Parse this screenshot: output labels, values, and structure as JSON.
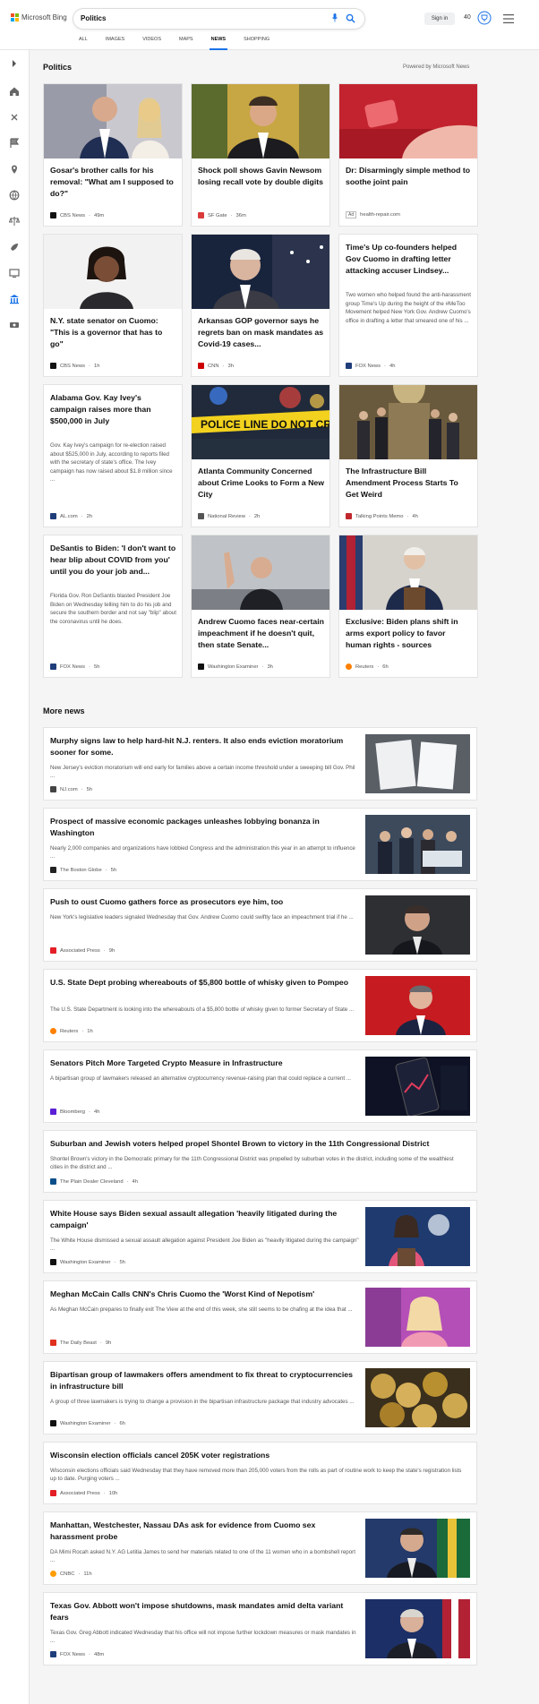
{
  "header": {
    "logo_text": "Microsoft Bing",
    "query": "Politics",
    "signin": "Sign in",
    "points": "40",
    "tabs": [
      {
        "label": "ALL"
      },
      {
        "label": "IMAGES"
      },
      {
        "label": "VIDEOS"
      },
      {
        "label": "MAPS"
      },
      {
        "label": "NEWS"
      },
      {
        "label": "SHOPPING"
      }
    ]
  },
  "section": {
    "title": "Politics",
    "powered": "Powered by Microsoft News"
  },
  "cards": [
    {
      "title": "Gosar's brother calls for his removal: \"What am I supposed to do?\"",
      "snippet": "",
      "source": "CBS News",
      "time": "49m"
    },
    {
      "title": "Shock poll shows Gavin Newsom losing recall vote by double digits",
      "snippet": "",
      "source": "SF Gate",
      "time": "36m"
    },
    {
      "title": "Dr: Disarmingly simple method to soothe joint pain",
      "snippet": "",
      "source": "health-repair.com",
      "time": "",
      "ad": "Ad"
    },
    {
      "title": "N.Y. state senator on Cuomo: \"This is a governor that has to go\"",
      "snippet": "",
      "source": "CBS News",
      "time": "1h"
    },
    {
      "title": "Arkansas GOP governor says he regrets ban on mask mandates as Covid-19 cases...",
      "snippet": "",
      "source": "CNN",
      "time": "3h"
    },
    {
      "title": "Time's Up co-founders helped Gov Cuomo in drafting letter attacking accuser Lindsey...",
      "snippet": "Two women who helped found the anti-harassment group Time's Up during the height of the #MeToo Movement helped New York Gov. Andrew Cuomo's office in drafting a letter that smeared one of his ...",
      "source": "FOX News",
      "time": "4h"
    },
    {
      "title": "Alabama Gov. Kay Ivey's campaign raises more than $500,000 in July",
      "snippet": "Gov. Kay Ivey's campaign for re-election raised about $525,000 in July, according to reports filed with the secretary of state's office. The Ivey campaign has now raised about $1.8 million since ...",
      "source": "AL.com",
      "time": "2h"
    },
    {
      "title": "Atlanta Community Concerned about Crime Looks to Form a New City",
      "snippet": "",
      "source": "National Review",
      "time": "2h"
    },
    {
      "title": "The Infrastructure Bill Amendment Process Starts To Get Weird",
      "snippet": "",
      "source": "Talking Points Memo",
      "time": "4h"
    },
    {
      "title": "DeSantis to Biden: 'I don't want to hear blip about COVID from you' until you do your job and...",
      "snippet": "Florida Gov. Ron DeSantis blasted President Joe Biden on Wednesday telling him to do his job and secure the southern border and not say \"blip\" about the coronavirus until he does.",
      "source": "FOX News",
      "time": "5h"
    },
    {
      "title": "Andrew Cuomo faces near-certain impeachment if he doesn't quit, then state Senate...",
      "snippet": "",
      "source": "Washington Examiner",
      "time": "3h"
    },
    {
      "title": "Exclusive: Biden plans shift in arms export policy to favor human rights - sources",
      "snippet": "",
      "source": "Reuters",
      "time": "6h"
    }
  ],
  "more_news": {
    "title": "More news",
    "items": [
      {
        "title": "Murphy signs law to help hard-hit N.J. renters. It also ends eviction moratorium sooner for some.",
        "snippet": "New Jersey's eviction moratorium will end early for families above a certain income threshold under a sweeping bill Gov. Phil ...",
        "source": "NJ.com",
        "time": "5h"
      },
      {
        "title": "Prospect of massive economic packages unleashes lobbying bonanza in Washington",
        "snippet": "Nearly 2,000 companies and organizations have lobbied Congress and the administration this year in an attempt to influence ...",
        "source": "The Boston Globe",
        "time": "5h"
      },
      {
        "title": "Push to oust Cuomo gathers force as prosecutors eye him, too",
        "snippet": "New York's legislative leaders signaled Wednesday that Gov. Andrew Cuomo could swiftly face an impeachment trial if he ...",
        "source": "Associated Press",
        "time": "9h"
      },
      {
        "title": "U.S. State Dept probing whereabouts of $5,800 bottle of whisky given to Pompeo",
        "snippet": "The U.S. State Department is looking into the whereabouts of a $5,800 bottle of whisky given to former Secretary of State ...",
        "source": "Reuters",
        "time": "1h"
      },
      {
        "title": "Senators Pitch More Targeted Crypto Measure in Infrastructure",
        "snippet": "A bipartisan group of lawmakers released an alternative cryptocurrency revenue-raising plan that could replace a current ...",
        "source": "Bloomberg",
        "time": "4h"
      },
      {
        "title": "Suburban and Jewish voters helped propel Shontel Brown to victory in the 11th Congressional District",
        "snippet": "Shontel Brown's victory in the Democratic primary for the 11th Congressional District was propelled by suburban votes in the district, including some of the wealthiest cities in the district and ...",
        "source": "The Plain Dealer Cleveland",
        "time": "4h"
      },
      {
        "title": "White House says Biden sexual assault allegation 'heavily litigated during the campaign'",
        "snippet": "The White House dismissed a sexual assault allegation against President Joe Biden as \"heavily litigated during the campaign\" ...",
        "source": "Washington Examiner",
        "time": "5h"
      },
      {
        "title": "Meghan McCain Calls CNN's Chris Cuomo the 'Worst Kind of Nepotism'",
        "snippet": "As Meghan McCain prepares to finally exit The View at the end of this week, she still seems to be chafing at the idea that ...",
        "source": "The Daily Beast",
        "time": "9h"
      },
      {
        "title": "Bipartisan group of lawmakers offers amendment to fix threat to cryptocurrencies in infrastructure bill",
        "snippet": "A group of three lawmakers is trying to change a provision in the bipartisan infrastructure package that industry advocates ...",
        "source": "Washington Examiner",
        "time": "6h"
      },
      {
        "title": "Wisconsin election officials cancel 205K voter registrations",
        "snippet": "Wisconsin elections officials said Wednesday that they have removed more than 205,000 voters from the rolls as part of routine work to keep the state's registration lists up to date. Purging voters ...",
        "source": "Associated Press",
        "time": "10h"
      },
      {
        "title": "Manhattan, Westchester, Nassau DAs ask for evidence from Cuomo sex harassment probe",
        "snippet": "DA Mimi Rocah asked N.Y. AG Letitia James to send her materials related to one of the 11 women who in a bombshell report ...",
        "source": "CNBC",
        "time": "11h"
      },
      {
        "title": "Texas Gov. Abbott won't impose shutdowns, mask mandates amid delta variant fears",
        "snippet": "Texas Gov. Greg Abbott indicated Wednesday that his office will not impose further lockdown measures or mask mandates in ...",
        "source": "FOX News",
        "time": "48m"
      }
    ]
  }
}
